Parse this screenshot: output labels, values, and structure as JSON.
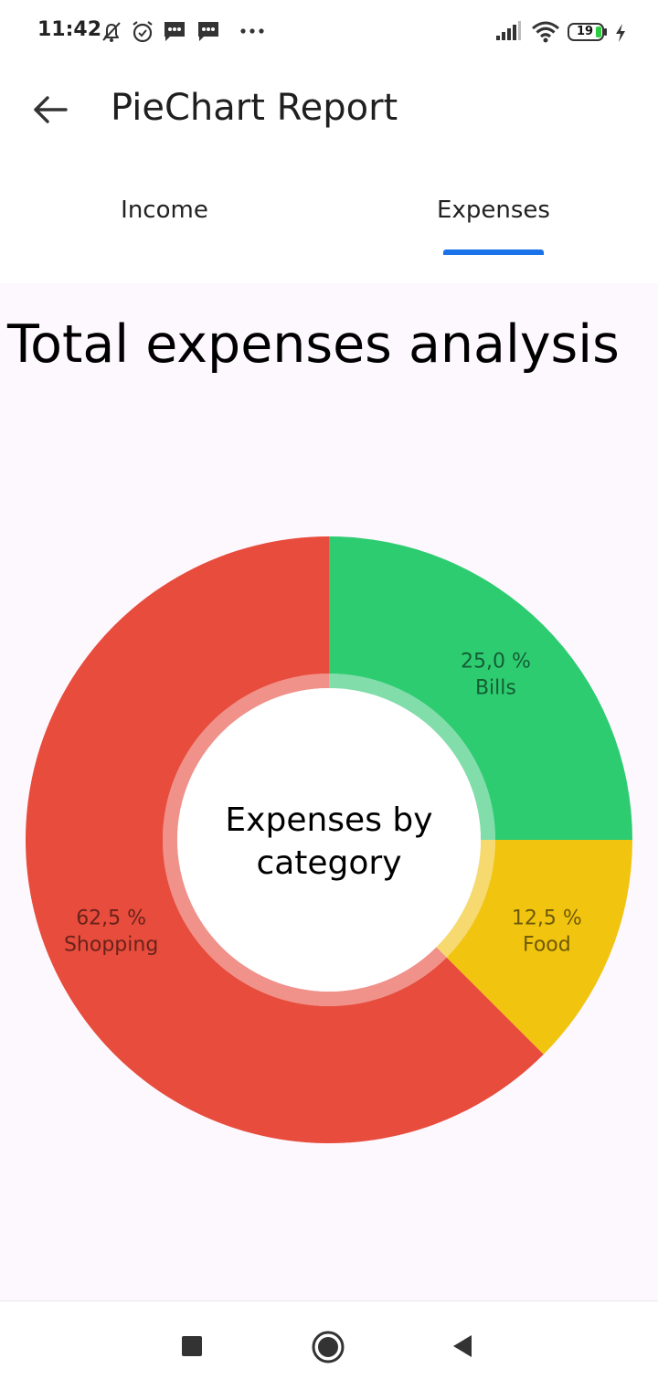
{
  "status_bar": {
    "time": "11:42",
    "battery_level": "19",
    "icons": [
      "silent-bell-icon",
      "alarm-icon",
      "message-icon",
      "message-icon",
      "more-dots-icon",
      "signal-icon",
      "wifi-icon",
      "battery-icon",
      "charging-icon"
    ]
  },
  "app_bar": {
    "title": "PieChart Report",
    "back_icon": "arrow-back-icon"
  },
  "tabs": [
    {
      "label": "Income",
      "selected": false
    },
    {
      "label": "Expenses",
      "selected": true
    }
  ],
  "colors": {
    "accent": "#1a73e8",
    "content_background": "#fdf7fe",
    "bills": "#2ecc71",
    "food": "#f1c40f",
    "shopping": "#e74c3c"
  },
  "heading": "Total expenses analysis",
  "chart_data": {
    "type": "pie",
    "style": "donut",
    "center_label_line1": "Expenses by",
    "center_label_line2": "category",
    "slices": [
      {
        "label": "Bills",
        "value": 25.0,
        "value_label": "25,0 %",
        "color": "#2ecc71"
      },
      {
        "label": "Food",
        "value": 12.5,
        "value_label": "12,5 %",
        "color": "#f1c40f"
      },
      {
        "label": "Shopping",
        "value": 62.5,
        "value_label": "62,5 %",
        "color": "#e74c3c"
      }
    ]
  },
  "nav_bar": {
    "buttons": [
      "recent-apps-icon",
      "home-icon",
      "back-triangle-icon"
    ]
  }
}
